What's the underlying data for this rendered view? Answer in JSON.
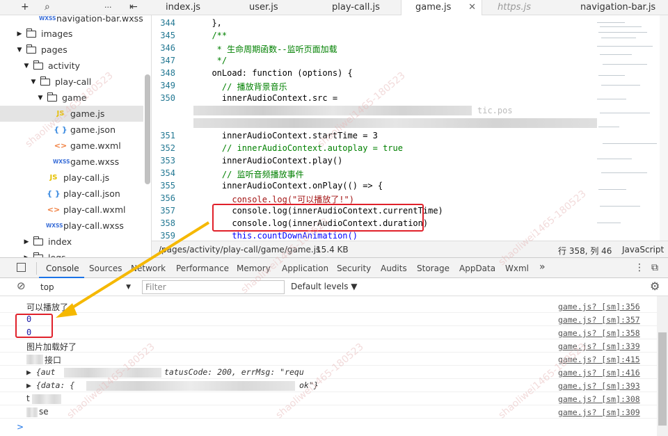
{
  "toolbar": {
    "add_icon": "+",
    "search_icon": "⌕",
    "more_icon": "···",
    "collapse_icon": "⇤"
  },
  "tree": {
    "items": [
      {
        "label": "navigation-bar.wxss",
        "kind": "wxss"
      },
      {
        "label": "images",
        "kind": "folder",
        "state": "collapsed"
      },
      {
        "label": "pages",
        "kind": "folder",
        "state": "expanded"
      },
      {
        "label": "activity",
        "kind": "folder",
        "state": "expanded"
      },
      {
        "label": "play-call",
        "kind": "folder",
        "state": "expanded"
      },
      {
        "label": "game",
        "kind": "folder",
        "state": "expanded"
      },
      {
        "label": "game.js",
        "kind": "js",
        "selected": true
      },
      {
        "label": "game.json",
        "kind": "json"
      },
      {
        "label": "game.wxml",
        "kind": "wxml"
      },
      {
        "label": "game.wxss",
        "kind": "wxss"
      },
      {
        "label": "play-call.js",
        "kind": "js"
      },
      {
        "label": "play-call.json",
        "kind": "json"
      },
      {
        "label": "play-call.wxml",
        "kind": "wxml"
      },
      {
        "label": "play-call.wxss",
        "kind": "wxss"
      },
      {
        "label": "index",
        "kind": "folder",
        "state": "collapsed"
      },
      {
        "label": "logs",
        "kind": "folder",
        "state": "collapsed"
      }
    ],
    "icon_text": {
      "js": "JS",
      "json": "{ }",
      "wxml": "<>",
      "wxss": "WXSS"
    }
  },
  "tabs": [
    {
      "label": "index.js"
    },
    {
      "label": "user.js"
    },
    {
      "label": "play-call.js"
    },
    {
      "label": "game.js",
      "active": true,
      "close": "✕"
    },
    {
      "label": "https.js",
      "italic": true
    },
    {
      "label": "navigation-bar.js"
    }
  ],
  "editor": {
    "lines": [
      {
        "num": "344",
        "text": "  },"
      },
      {
        "num": "345",
        "text": "  /**"
      },
      {
        "num": "346",
        "text": "   * 生命周期函数--监听页面加载"
      },
      {
        "num": "347",
        "text": "   */"
      },
      {
        "num": "348",
        "text": "  onLoad: function (options) {"
      },
      {
        "num": "349",
        "text": "    // 播放背景音乐"
      },
      {
        "num": "350",
        "text": "    innerAudioContext.src ="
      },
      {
        "num": "",
        "text": ""
      },
      {
        "num": "",
        "text": ""
      },
      {
        "num": "351",
        "text": "    innerAudioContext.startTime = 3"
      },
      {
        "num": "352",
        "text": "    // innerAudioContext.autoplay = true"
      },
      {
        "num": "353",
        "text": "    innerAudioContext.play()"
      },
      {
        "num": "354",
        "text": "    // 监听音频播放事件"
      },
      {
        "num": "355",
        "text": "    innerAudioContext.onPlay(() => {"
      },
      {
        "num": "356",
        "text": "      console.log(\"可以播放了!\")"
      },
      {
        "num": "357",
        "text": "      console.log(innerAudioContext.currentTime)"
      },
      {
        "num": "358",
        "text": "      console.log(innerAudioContext.duration)"
      },
      {
        "num": "359",
        "text": "      this.countDownAnimation()"
      }
    ],
    "partial_text_350": "tic.pos"
  },
  "status": {
    "path": "/pages/activity/play-call/game/game.js",
    "size": "15.4 KB",
    "cursor": "行 358, 列 46",
    "language": "JavaScript"
  },
  "devtools": {
    "tabs": [
      "Console",
      "Sources",
      "Network",
      "Performance",
      "Memory",
      "Application",
      "Security",
      "Audits",
      "Storage",
      "AppData",
      "Wxml",
      "»"
    ],
    "active_tab": "Console",
    "more_icon": "⋮",
    "dock_icon": "⧉"
  },
  "filter": {
    "clear_icon": "⊘",
    "context": "top",
    "filter_placeholder": "Filter",
    "levels": "Default levels ▼",
    "settings_icon": "⚙"
  },
  "console": {
    "rows": [
      {
        "msg": "可以播放了",
        "src": "game.js? [sm]:356"
      },
      {
        "msg": "0",
        "numeric": true,
        "src": "game.js? [sm]:357"
      },
      {
        "msg": "0",
        "numeric": true,
        "src": "game.js? [sm]:358"
      },
      {
        "msg": "图片加载好了",
        "src": "game.js? [sm]:339"
      },
      {
        "msg": "接口",
        "src": "game.js? [sm]:415"
      },
      {
        "msg": "▶ {aut",
        "obj_mid": "tatusCode: 200, errMsg: \"requ",
        "src": "game.js? [sm]:416"
      },
      {
        "msg": "▶ {data: {",
        "obj_mid": "ok\"}",
        "src": "game.js? [sm]:393"
      },
      {
        "msg": "t",
        "src": "game.js? [sm]:308"
      },
      {
        "msg": "se",
        "src": "game.js? [sm]:309"
      }
    ],
    "prompt": ">"
  },
  "watermark": "shaoliwei1465-180523",
  "colors": {
    "highlight": "#e0202a",
    "arrow": "#f5b800",
    "accent": "#1a73e8"
  }
}
